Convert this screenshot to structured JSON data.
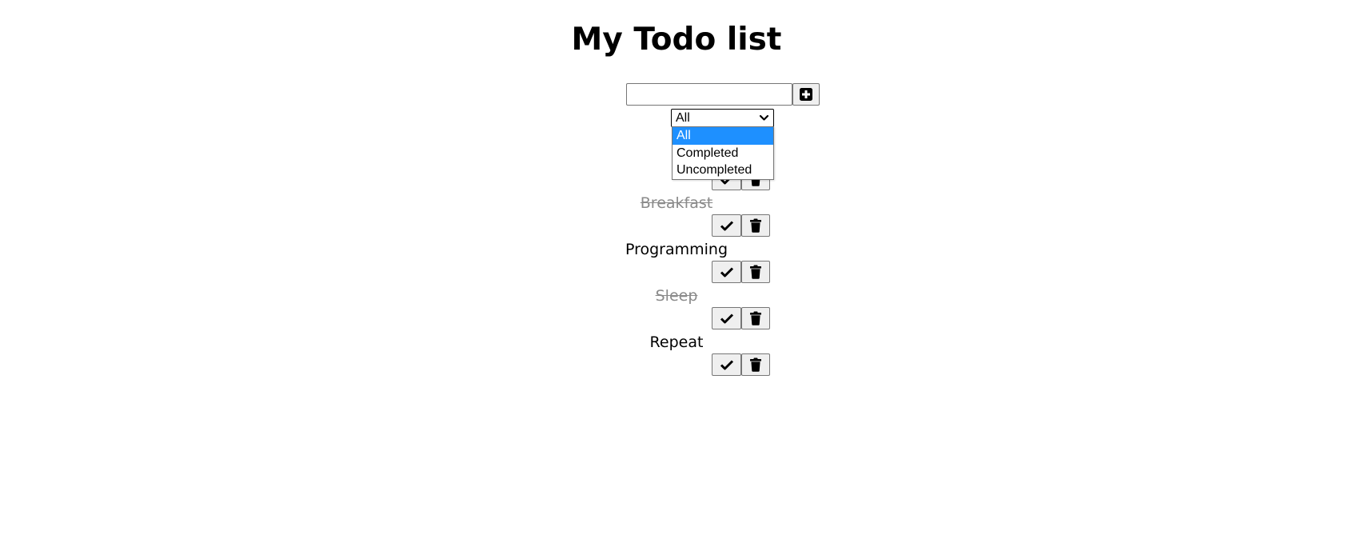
{
  "header": {
    "title": "My Todo list"
  },
  "form": {
    "input_value": "",
    "add_icon": "plus-square-icon"
  },
  "filter": {
    "selected": "All",
    "options": [
      "All",
      "Completed",
      "Uncompleted"
    ],
    "highlighted_option": "All",
    "accent_color": "#1e90ff"
  },
  "todos": [
    {
      "text": "",
      "completed": false
    },
    {
      "text": "Breakfast",
      "completed": true
    },
    {
      "text": "Programming",
      "completed": false
    },
    {
      "text": "Sleep",
      "completed": true
    },
    {
      "text": "Repeat",
      "completed": false
    }
  ],
  "icons": {
    "complete": "check-icon",
    "delete": "trash-icon",
    "dropdown": "chevron-down-icon"
  },
  "colors": {
    "completed_text": "#8a8a8a",
    "button_bg": "#efefef"
  }
}
